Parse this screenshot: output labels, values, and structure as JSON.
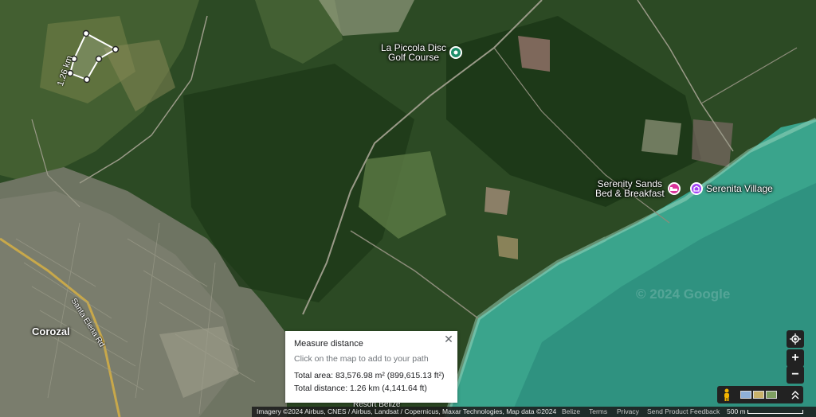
{
  "map": {
    "pois": {
      "golf": {
        "name": "La Piccola Disc Golf Course",
        "line1": "La Piccola Disc",
        "line2": "Golf Course",
        "color": "#1e8e6a"
      },
      "serenity_sands": {
        "name": "Serenity Sands Bed & Breakfast",
        "line1": "Serenity Sands",
        "line2": "Bed & Breakfast",
        "color": "#d9339a"
      },
      "serenita_village": {
        "name": "Serenita Village",
        "color": "#a142f4"
      }
    },
    "town_label": "Corozal",
    "road_label": "Santa Elena Rd",
    "partial_label": "Resort Belize",
    "measure_line_label": "1.26 km",
    "watermark": "© 2024 Google"
  },
  "measure_card": {
    "title": "Measure distance",
    "hint": "Click on the map to add to your path",
    "total_area": "Total area: 83,576.98 m² (899,615.13 ft²)",
    "total_distance": "Total distance: 1.26 km (4,141.64 ft)",
    "close_icon": "close-icon"
  },
  "controls": {
    "location_icon": "my-location-icon",
    "zoom_in": "+",
    "zoom_out": "−",
    "pegman_icon": "pegman-icon",
    "expand_icon": "chevron-up-icon"
  },
  "footer": {
    "attribution": "Imagery ©2024 Airbus, CNES / Airbus, Landsat / Copernicus, Maxar Technologies, Map data ©2024",
    "region": "Belize",
    "terms": "Terms",
    "privacy": "Privacy",
    "feedback": "Send Product Feedback",
    "scale": "500 m"
  },
  "colors": {
    "land_dark": "#243f1d",
    "land_mid": "#3a5a2c",
    "sea": "#3fa98f",
    "deep_sea": "#2b8c7d"
  }
}
